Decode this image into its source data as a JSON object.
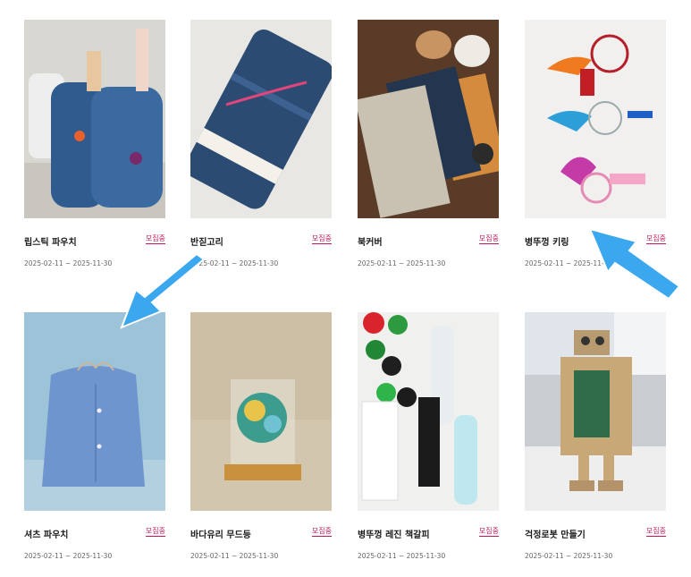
{
  "products": [
    {
      "title": "립스틱 파우치",
      "badge": "모집중",
      "dates": "2025-02-11 ~ 2025-11-30"
    },
    {
      "title": "반짇고리",
      "badge": "모집중",
      "dates": "2025-02-11 ~ 2025-11-30"
    },
    {
      "title": "북커버",
      "badge": "모집중",
      "dates": "2025-02-11 ~ 2025-11-30"
    },
    {
      "title": "병뚜껑 키링",
      "badge": "모집중",
      "dates": "2025-02-11 ~ 2025-11-30"
    },
    {
      "title": "셔츠 파우치",
      "badge": "모집중",
      "dates": "2025-02-11 ~ 2025-11-30"
    },
    {
      "title": "바다유리 무드등",
      "badge": "모집중",
      "dates": "2025-02-11 ~ 2025-11-30"
    },
    {
      "title": "병뚜껑 레진 책갈피",
      "badge": "모집중",
      "dates": "2025-02-11 ~ 2025-11-30"
    },
    {
      "title": "걱정로봇 만들기",
      "badge": "모집중",
      "dates": "2025-02-11 ~ 2025-11-30"
    }
  ],
  "colors": {
    "badge": "#c2185b",
    "arrow": "#3aa7ee"
  },
  "icons": [
    "arrow-pointing-down-left-icon",
    "arrow-pointing-up-left-icon"
  ]
}
